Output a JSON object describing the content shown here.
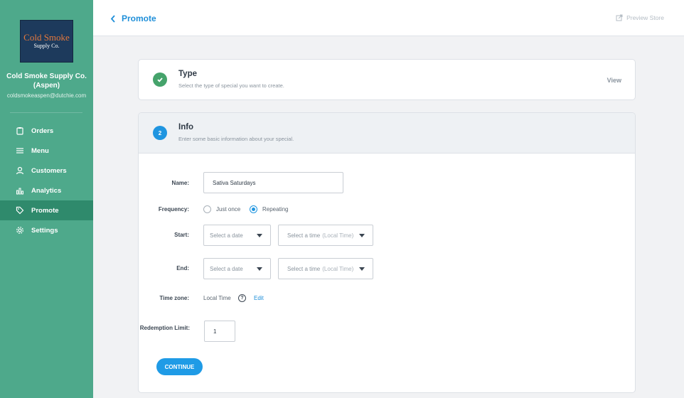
{
  "sidebar": {
    "logo": {
      "line1": "Cold Smoke",
      "line2": "Supply Co."
    },
    "store_name": "Cold Smoke Supply Co. (Aspen)",
    "store_email": "coldsmokeaspen@dutchie.com",
    "items": [
      {
        "label": "Orders",
        "icon": "clipboard-icon"
      },
      {
        "label": "Menu",
        "icon": "menu-icon"
      },
      {
        "label": "Customers",
        "icon": "user-icon"
      },
      {
        "label": "Analytics",
        "icon": "bar-chart-icon"
      },
      {
        "label": "Promote",
        "icon": "tag-icon",
        "active": true
      },
      {
        "label": "Settings",
        "icon": "gear-icon"
      }
    ]
  },
  "topbar": {
    "back_label": "Promote",
    "preview_label": "Preview Store"
  },
  "step1": {
    "title": "Type",
    "subtitle": "Select the type of special you want to create.",
    "view_label": "View"
  },
  "step2": {
    "number": "2",
    "title": "Info",
    "subtitle": "Enter some basic information about your special."
  },
  "form": {
    "name_label": "Name:",
    "name_value": "Sativa Saturdays",
    "frequency_label": "Frequency:",
    "frequency_options": [
      "Just once",
      "Repeating"
    ],
    "frequency_selected": "Repeating",
    "start_label": "Start:",
    "end_label": "End:",
    "date_placeholder": "Select a date",
    "time_placeholder": "Select a time",
    "time_suffix": "(Local Time)",
    "timezone_label": "Time zone:",
    "timezone_value": "Local Time",
    "help_symbol": "?",
    "edit_label": "Edit",
    "redemption_label": "Redemption Limit:",
    "redemption_value": "1",
    "continue_label": "CONTINUE"
  },
  "colors": {
    "sidebar": "#4ea98b",
    "sidebar_active": "#2f8a6c",
    "accent_blue": "#1f9be6",
    "check_green": "#45a36b"
  }
}
